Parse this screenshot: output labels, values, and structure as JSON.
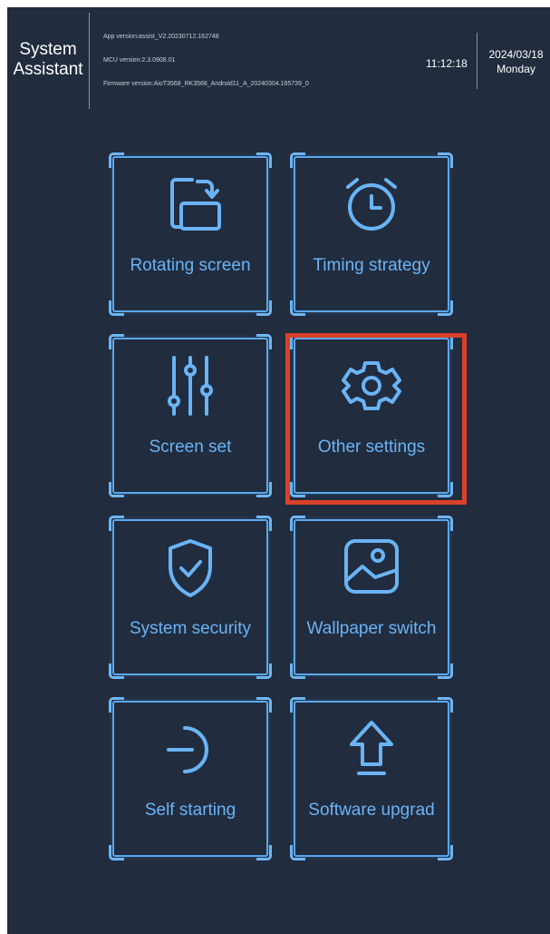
{
  "header": {
    "app_title_line1": "System",
    "app_title_line2": "Assistant",
    "app_version": "App version:assist_V2.20230712.162748",
    "mcu_version": "MCU version:2.3.0908.01",
    "firmware_version": "Firmware version:AioT3568_RK3568_Android11_A_20240304.165739_0",
    "time": "11:12:18",
    "date": "2024/03/18",
    "weekday": "Monday"
  },
  "tiles": [
    {
      "label": "Rotating screen",
      "icon": "rotate-screen-icon"
    },
    {
      "label": "Timing strategy",
      "icon": "alarm-clock-icon"
    },
    {
      "label": "Screen set",
      "icon": "sliders-icon"
    },
    {
      "label": "Other settings",
      "icon": "gear-icon"
    },
    {
      "label": "System security",
      "icon": "shield-check-icon"
    },
    {
      "label": "Wallpaper switch",
      "icon": "image-icon"
    },
    {
      "label": "Self starting",
      "icon": "power-icon"
    },
    {
      "label": "Software upgrad",
      "icon": "upload-arrow-icon"
    }
  ],
  "colors": {
    "background": "#212c3f",
    "accent": "#5aa8ee",
    "highlight": "#d8412a"
  },
  "highlighted_tile": "Other settings"
}
